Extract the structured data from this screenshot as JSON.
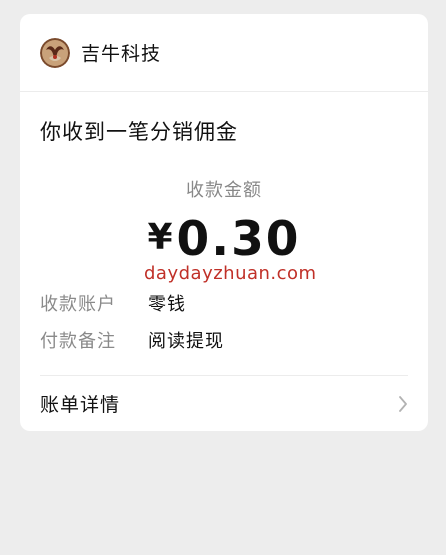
{
  "merchant": {
    "name": "吉牛科技",
    "avatar_icon": "brand-logo-icon"
  },
  "message_title": "你收到一笔分销佣金",
  "amount": {
    "label": "收款金额",
    "currency": "¥",
    "value": "0.30"
  },
  "watermark": "daydayzhuan.com",
  "details": [
    {
      "key": "收款账户",
      "value": "零钱"
    },
    {
      "key": "付款备注",
      "value": "阅读提现"
    }
  ],
  "footer_link": {
    "label": "账单详情",
    "icon": "chevron-right-icon"
  },
  "colors": {
    "background": "#ededed",
    "card": "#ffffff",
    "watermark": "#c03028",
    "muted_text": "#888888"
  }
}
